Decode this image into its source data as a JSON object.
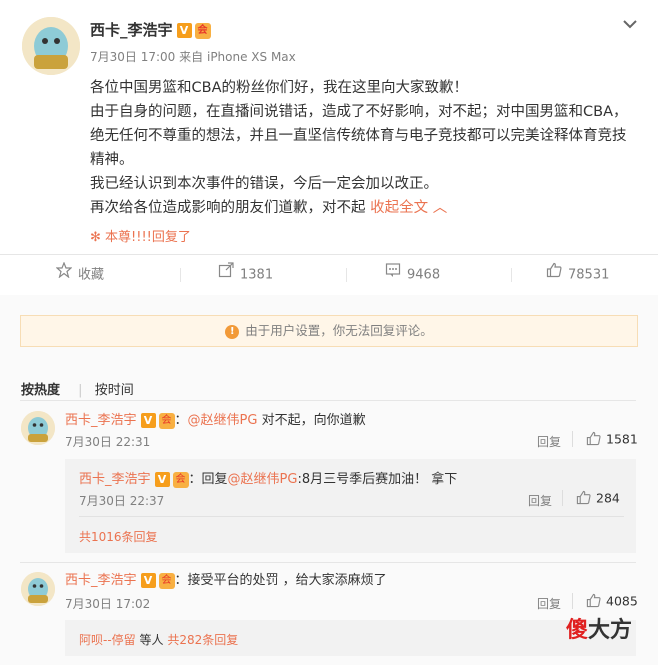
{
  "post": {
    "author": "西卡_李浩宇",
    "verified_badge": "V",
    "vip_badge": "会",
    "date": "7月30日 17:00",
    "source_prefix": "来自",
    "source": "iPhone XS Max",
    "paragraphs": [
      "各位中国男篮和CBA的粉丝你们好，我在这里向大家致歉！",
      "由于自身的问题，在直播间说错话，造成了不好影响，对不起；对中国男篮和CBA，绝无任何不尊重的想法，并且一直坚信传统体育与电子竞技都可以完美诠释体育竞技精神。",
      "我已经认识到本次事件的错误，今后一定会加以改正。",
      "再次给各位造成影响的朋友们道歉，对不起"
    ],
    "collapse_label": "收起全文",
    "reply_tag": "本尊!!!!回复了",
    "actions": {
      "favorite": "收藏",
      "repost": "1381",
      "comment": "9468",
      "like": "78531"
    }
  },
  "comments_section": {
    "notice": "由于用户设置，你无法回复评论。",
    "sort_hot": "按热度",
    "sort_time": "按时间",
    "items": [
      {
        "author": "西卡_李浩宇",
        "mention": "@赵继伟PG",
        "text": "对不起，向你道歉",
        "time": "7月30日 22:31",
        "reply_label": "回复",
        "likes": "1581"
      },
      {
        "author": "西卡_李浩宇",
        "reply_prefix": "回复",
        "mention": "@赵继伟PG",
        "text": ":8月三号季后赛加油！ 拿下",
        "time": "7月30日 22:37",
        "reply_label": "回复",
        "likes": "284"
      },
      {
        "author": "西卡_李浩宇",
        "text": "接受平台的处罚 ，给大家添麻烦了",
        "time": "7月30日 17:02",
        "reply_label": "回复",
        "likes": "4085"
      }
    ],
    "more_replies_1": "共1016条回复",
    "more_replies_2_user": "阿呗--停留",
    "more_replies_2_mid": "等人",
    "more_replies_2_count": "共282条回复"
  },
  "watermark": {
    "part1": "傻",
    "part2": "大方"
  },
  "colors": {
    "accent": "#eb7350",
    "badge_orange": "#f69e1c"
  }
}
